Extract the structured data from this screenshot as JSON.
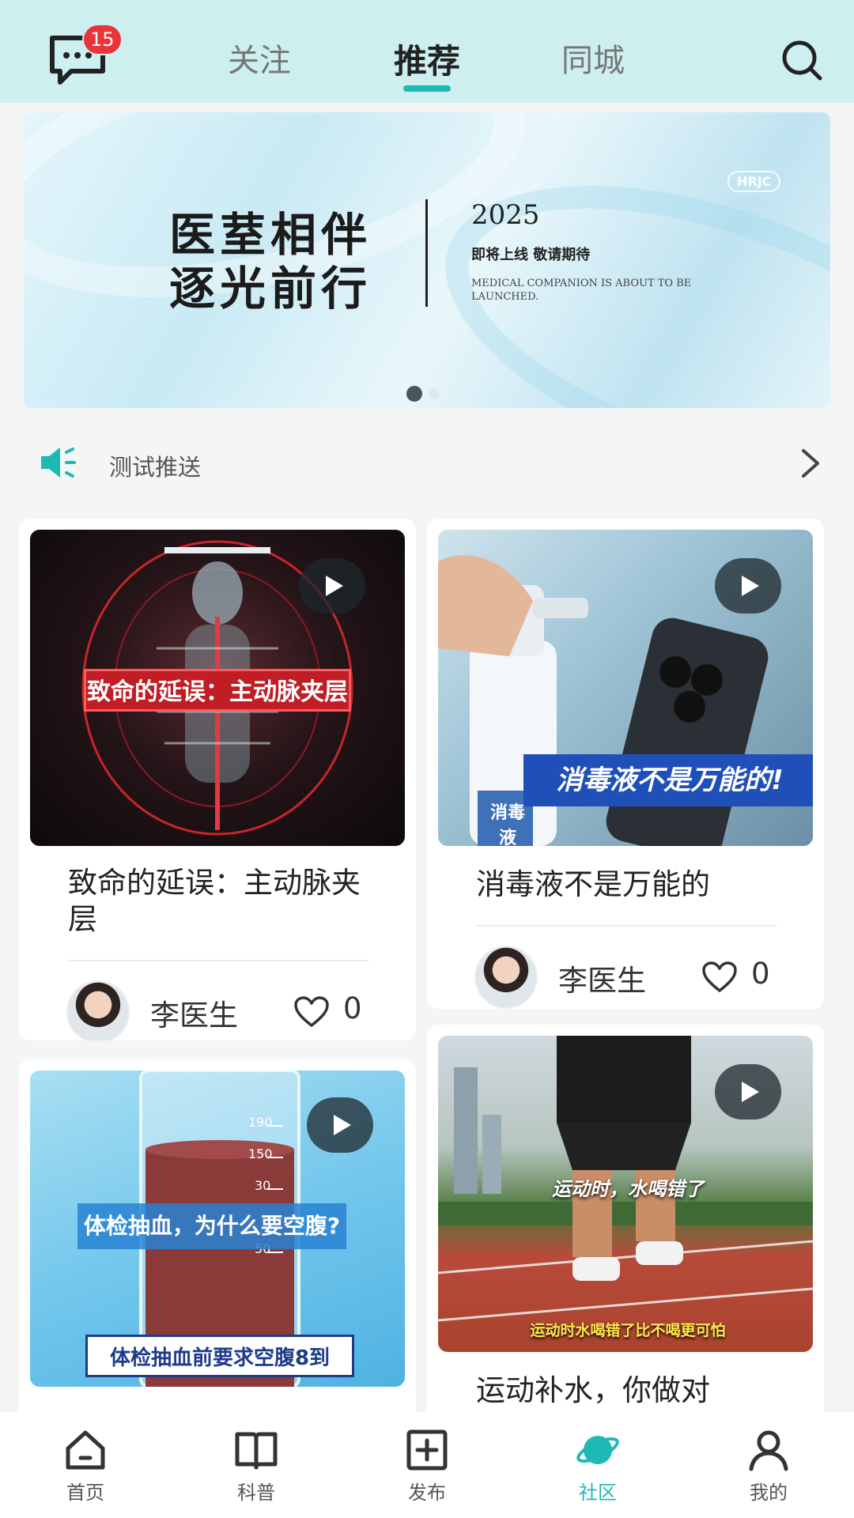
{
  "header": {
    "messages_badge": "15",
    "tabs": [
      {
        "label": "关注"
      },
      {
        "label": "推荐",
        "active": true
      },
      {
        "label": "同城"
      }
    ]
  },
  "banner": {
    "title_line1": "医荎相伴",
    "title_line2": "逐光前行",
    "year": "2025",
    "subtitle": "即将上线 敬请期待",
    "english": "MEDICAL COMPANION IS ABOUT TO BE LAUNCHED.",
    "logo": "HRJC",
    "page_count": 2,
    "active_page": 1
  },
  "notice": {
    "text": "测试推送"
  },
  "feed": [
    {
      "title": "致命的延误：主动脉夹层",
      "image_caption": "致命的延误：主动脉夹层",
      "author": "李医生",
      "likes": "0"
    },
    {
      "title": "消毒液不是万能的",
      "image_caption": "消毒液不是万能的!",
      "image_label": "消毒液",
      "author": "李医生",
      "likes": "0"
    },
    {
      "image_caption": "体检抽血，为什么要空腹?",
      "image_caption2": "体检抽血前要求空腹8到",
      "tube_marks": [
        "190",
        "150",
        "30",
        "50"
      ]
    },
    {
      "title": "运动补水，你做对",
      "image_caption": "运动时，水喝错了",
      "image_caption2": "运动时水喝错了比不喝更可怕"
    }
  ],
  "bottom_nav": [
    {
      "label": "首页",
      "icon": "home-icon"
    },
    {
      "label": "科普",
      "icon": "book-icon"
    },
    {
      "label": "发布",
      "icon": "add-square-icon"
    },
    {
      "label": "社区",
      "icon": "planet-icon",
      "active": true
    },
    {
      "label": "我的",
      "icon": "user-icon"
    }
  ],
  "colors": {
    "accent": "#1fb9b5",
    "header_bg": "#cdeff0",
    "badge": "#e8343a"
  }
}
